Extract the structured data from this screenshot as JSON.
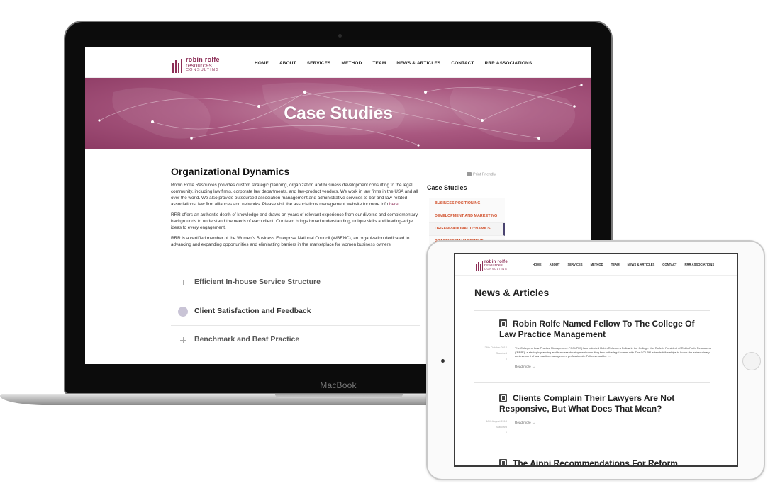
{
  "macbook": {
    "brand_label": "MacBook",
    "site": {
      "logo": {
        "line1": "robin rolfe",
        "line2": "resources",
        "line3": "CONSULTING"
      },
      "nav": [
        "HOME",
        "ABOUT",
        "SERVICES",
        "METHOD",
        "TEAM",
        "NEWS & ARTICLES",
        "CONTACT",
        "RRR ASSOCIATIONS"
      ],
      "hero_title": "Case Studies",
      "page_heading": "Organizational Dynamics",
      "paragraphs": {
        "p1": "Robin Rolfe Resources provides custom strategic planning, organization and business development consulting to the legal community, including law firms, corporate law departments, and law-product vendors. We work in law firms in the USA and all over the world.  We also provide outsourced association management and administrative services to bar and law-related associations, law firm alliances and networks.  Please visit the associations management website for more info ",
        "p1_link": "here.",
        "p2": "RRR offers an authentic depth of knowledge and draws on years of relevant experience from our diverse and complementary backgrounds to understand the needs of each client. Our team brings broad understanding, unique skills and leading-edge ideas to every engagement.",
        "p3": "RRR is a certified member of the Women's Business Enterprise National Council (WBENC), an organization dedicated to advancing and expanding opportunities and eliminating barriers in the marketplace for women business owners."
      },
      "accordion": [
        "Efficient In-house Service Structure",
        "Client Satisfaction and Feedback",
        "Benchmark and Best Practice"
      ],
      "sidebar": {
        "print_label": "Print Friendly",
        "title": "Case Studies",
        "items": [
          "BUSINESS POSITIONING",
          "DEVELOPMENT AND MARKETING",
          "ORGANIZATIONAL DYNAMICS",
          "PRACTICE MANAGEMENT"
        ]
      }
    }
  },
  "ipad": {
    "site": {
      "logo": {
        "line1": "robin rolfe",
        "line2": "resources",
        "line3": "CONSULTING"
      },
      "nav": [
        "HOME",
        "ABOUT",
        "SERVICES",
        "METHOD",
        "TEAM",
        "NEWS & ARTICLES",
        "CONTACT",
        "RRR ASSOCIATIONS"
      ],
      "page_title": "News & Articles",
      "posts": [
        {
          "title": "Robin Rolfe Named Fellow To The College Of Law Practice Management",
          "date": "28th October 2014",
          "format": "Standard",
          "comments": "0",
          "excerpt": "The College of Law Practice Management (\"COLPM\") has inducted Robin Rolfe as a Fellow in the College. Ms. Rolfe is President of Robin Rolfe Resources (\"RRR\"), a strategic planning and business development consulting firm to the legal community. The COLPM extends fellowships to honor the extraordinary achievement of law practice management professionals. Fellows must be [...]",
          "read_more": "Read more →"
        },
        {
          "title": "Clients Complain Their Lawyers Are Not Responsive, But What Does That Mean?",
          "date": "18th August 2013",
          "format": "Standard",
          "comments": "0",
          "excerpt": "",
          "read_more": "Read more →"
        },
        {
          "title": "The Aippi Recommendations For Reform",
          "date": "",
          "format": "",
          "comments": "",
          "excerpt": "",
          "read_more": ""
        }
      ]
    }
  },
  "colors": {
    "brand": "#8d2e57",
    "accent_link": "#d2532f",
    "hero": "#a95880"
  }
}
